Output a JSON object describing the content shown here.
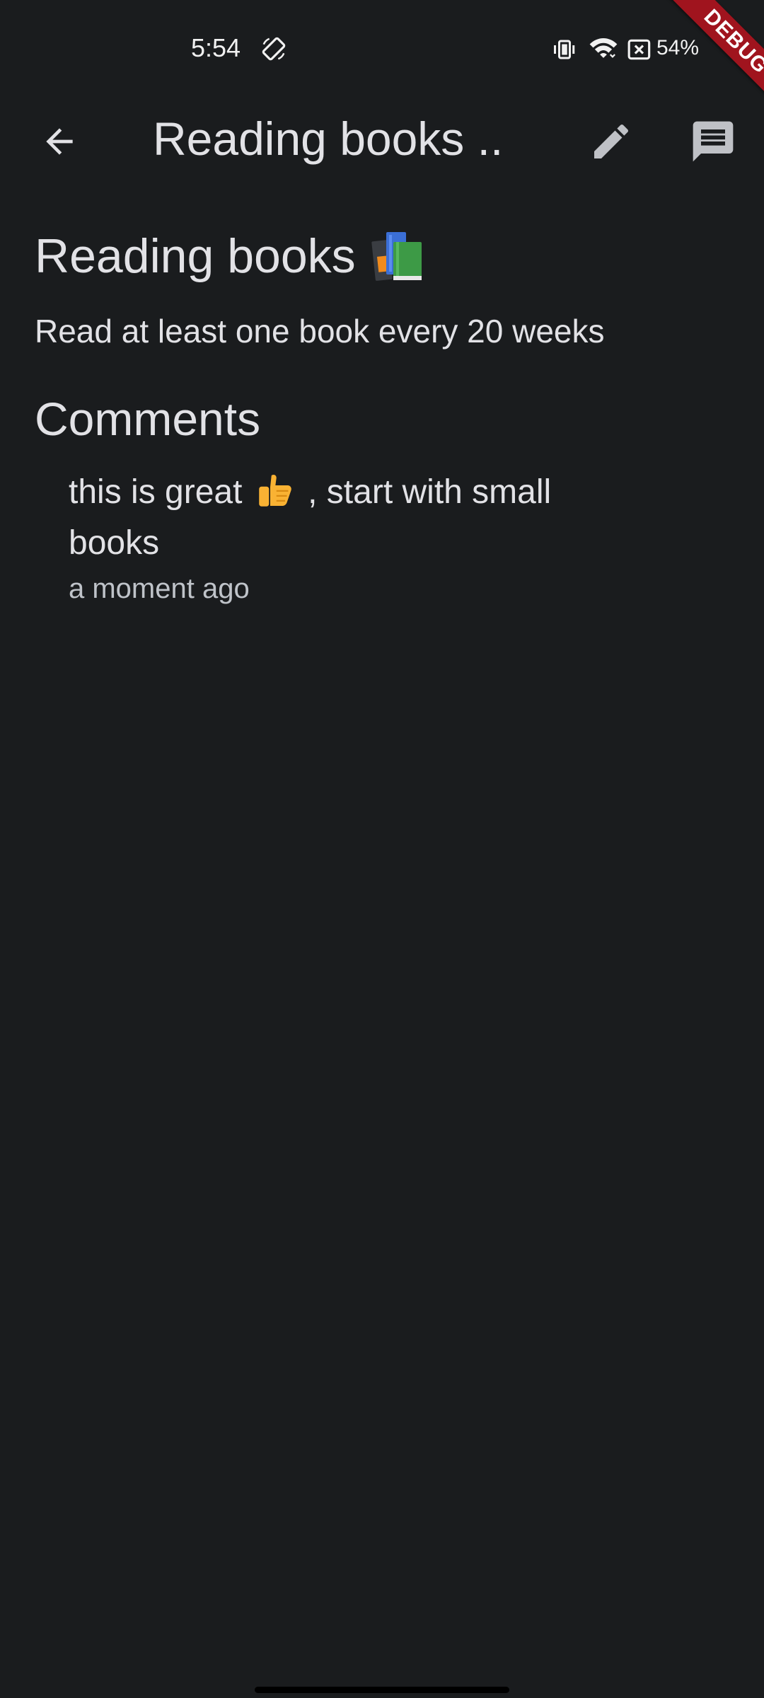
{
  "status_bar": {
    "time": "5:54",
    "battery": "54%",
    "icons": [
      "screen-rotate-icon",
      "vibrate-icon",
      "wifi-icon",
      "battery-saver-icon"
    ]
  },
  "debug_banner": {
    "label": "DEBUG",
    "color": "#a0141e"
  },
  "app_bar": {
    "title": "Reading books ...",
    "icons": [
      "back-arrow-icon",
      "pencil-icon",
      "comment-icon"
    ]
  },
  "habit": {
    "title": "Reading books",
    "title_icon": "books-icon",
    "description": "Read at least one book every 20 weeks"
  },
  "comments": {
    "heading": "Comments",
    "items": [
      {
        "text_before": "this is great",
        "icon": "thumbs-up-icon",
        "text_after": ", start with small books",
        "time": "a moment ago"
      }
    ]
  },
  "colors": {
    "background": "#1a1c1e",
    "text": "#e2e2e6",
    "secondary_text": "#bfc3c9"
  }
}
